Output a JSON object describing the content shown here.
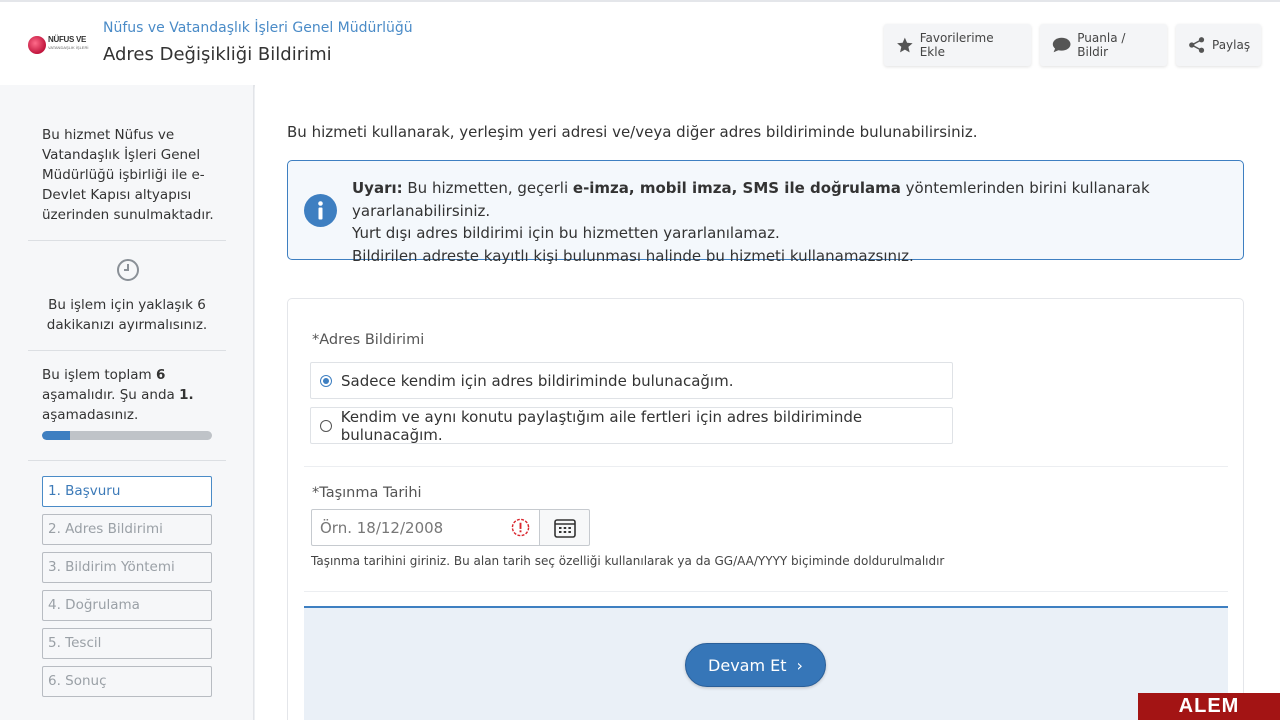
{
  "header": {
    "logo_text": "NÜFUS VE",
    "logo_subtext": "VATANDAŞLIK İŞLERİ",
    "subtitle": "Nüfus ve Vatandaşlık İşleri Genel Müdürlüğü",
    "title": "Adres Değişikliği Bildirimi",
    "actions": {
      "favorite": "Favorilerime Ekle",
      "rate": "Puanla / Bildir",
      "share": "Paylaş"
    }
  },
  "sidebar": {
    "info": "Bu hizmet Nüfus ve Vatandaşlık İşleri Genel Müdürlüğü işbirliği ile e-Devlet Kapısı altyapısı üzerinden sunulmaktadır.",
    "time_text": "Bu işlem için yaklaşık 6 dakikanızı ayırmalısınız.",
    "step_prefix": "Bu işlem toplam ",
    "step_total": "6",
    "step_mid": " aşamalıdır. Şu anda ",
    "step_current": "1.",
    "step_suffix": " aşamadasınız.",
    "progress_fraction": 0.1667,
    "steps": [
      {
        "label": "1. Başvuru"
      },
      {
        "label": "2. Adres Bildirimi"
      },
      {
        "label": "3. Bildirim Yöntemi"
      },
      {
        "label": "4. Doğrulama"
      },
      {
        "label": "5. Tescil"
      },
      {
        "label": "6. Sonuç"
      }
    ]
  },
  "main": {
    "intro": "Bu hizmeti kullanarak, yerleşim yeri adresi ve/veya diğer adres bildiriminde bulunabilirsiniz.",
    "warning": {
      "label": "Uyarı:",
      "line1_a": " Bu hizmetten, geçerli ",
      "line1_bold": "e-imza, mobil imza, SMS ile doğrulama",
      "line1_b": " yöntemlerinden birini kullanarak yararlanabilirsiniz.",
      "line2": "Yurt dışı adres bildirimi için bu hizmetten yararlanılamaz.",
      "line3": "Bildirilen adreste kayıtlı kişi bulunması halinde bu hizmeti kullanamazsınız."
    },
    "form": {
      "address_label": "*Adres Bildirimi",
      "option1": "Sadece kendim için adres bildiriminde bulunacağım.",
      "option2": "Kendim ve aynı konutu paylaştığım aile fertleri için adres bildiriminde bulunacağım.",
      "date_label": "*Taşınma Tarihi",
      "date_placeholder": "Örn. 18/12/2008",
      "date_value": "",
      "hint": "Taşınma tarihini giriniz. Bu alan tarih seç özelliği kullanılarak ya da GG/AA/YYYY biçiminde doldurulmalıdır",
      "submit": "Devam Et"
    }
  },
  "watermark": "ALEM HABER",
  "colors": {
    "accent": "#3e7fc1",
    "link": "#4a8bc7",
    "error": "#d9262e"
  }
}
